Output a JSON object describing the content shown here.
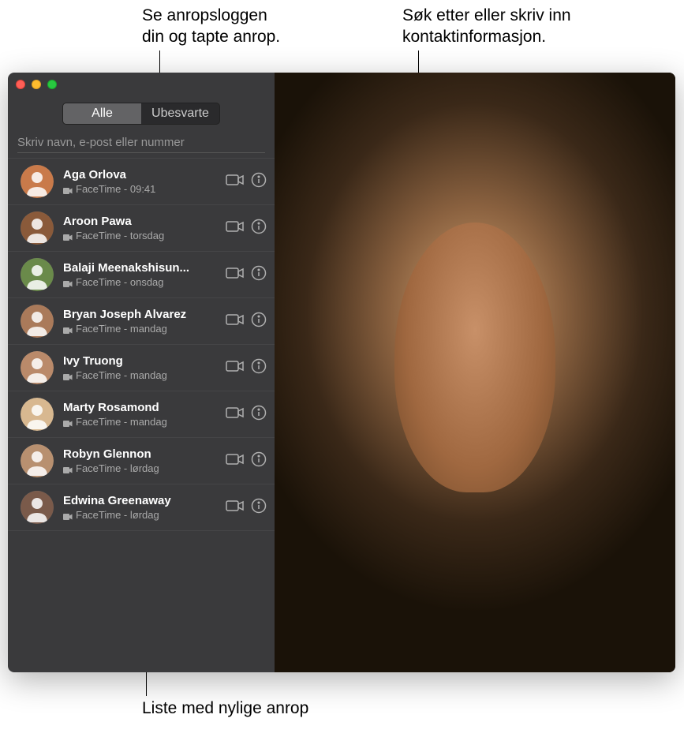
{
  "callouts": {
    "top_left": "Se anropsloggen\ndin og tapte anrop.",
    "top_right": "Søk etter eller skriv inn\nkontaktinformasjon.",
    "bottom": "Liste med nylige anrop"
  },
  "segments": {
    "all": "Alle",
    "missed": "Ubesvarte"
  },
  "search": {
    "placeholder": "Skriv navn, e-post eller nummer"
  },
  "calls": [
    {
      "name": "Aga Orlova",
      "meta": "FaceTime - 09:41",
      "avatar_bg": "#c97a4a"
    },
    {
      "name": "Aroon Pawa",
      "meta": "FaceTime - torsdag",
      "avatar_bg": "#8a5a3a"
    },
    {
      "name": "Balaji Meenakshisun...",
      "meta": "FaceTime - onsdag",
      "avatar_bg": "#6a8a4a"
    },
    {
      "name": "Bryan Joseph Alvarez",
      "meta": "FaceTime - mandag",
      "avatar_bg": "#aa7a5a"
    },
    {
      "name": "Ivy Truong",
      "meta": "FaceTime - mandag",
      "avatar_bg": "#ba8a6a"
    },
    {
      "name": "Marty Rosamond",
      "meta": "FaceTime - mandag",
      "avatar_bg": "#d8b890"
    },
    {
      "name": "Robyn Glennon",
      "meta": "FaceTime - lørdag",
      "avatar_bg": "#b89070"
    },
    {
      "name": "Edwina Greenaway",
      "meta": "FaceTime - lørdag",
      "avatar_bg": "#7a5a4a"
    }
  ]
}
